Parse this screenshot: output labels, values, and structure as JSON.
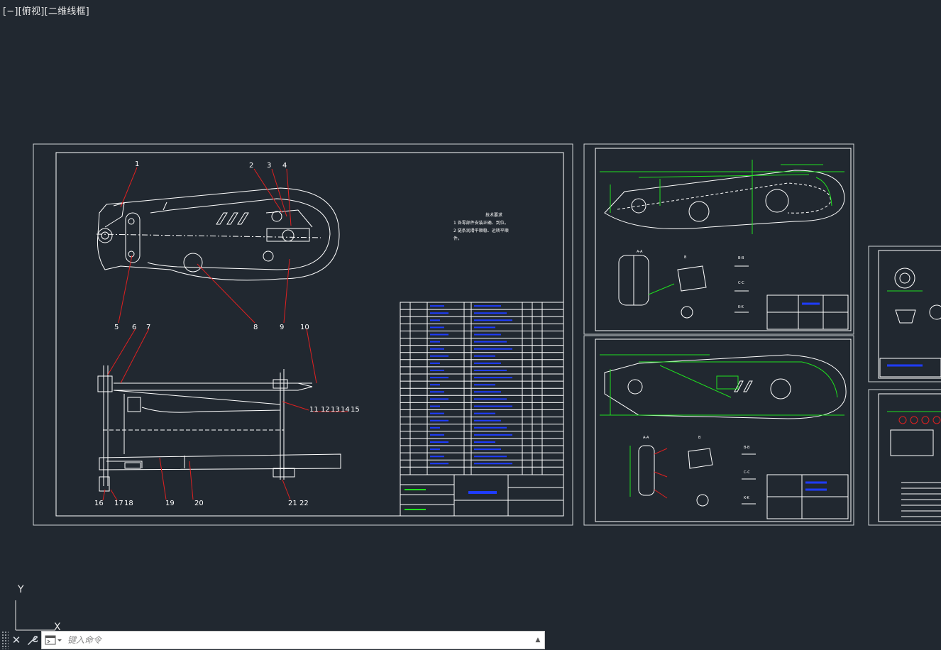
{
  "viewport": {
    "minus": "[−]",
    "view": "[俯视]",
    "style": "[二维线框]"
  },
  "colors": {
    "background": "#212830",
    "line": "#ffffff",
    "leader": "#e02020",
    "dimension": "#1fe01f",
    "tableText": "#1e3cff"
  },
  "sheet1": {
    "balloons_top": [
      "1",
      "2",
      "3",
      "4"
    ],
    "balloons_mid": [
      "5",
      "6",
      "7",
      "8",
      "9",
      "10"
    ],
    "balloons_side": [
      "11",
      "12",
      "13",
      "14",
      "15"
    ],
    "balloons_bottom": [
      "16",
      "17",
      "18",
      "19",
      "20",
      "21",
      "22"
    ],
    "notes_title": "技术要求",
    "notes": [
      "1  各零部件安装正确、到位。",
      "2  链条润滑平顺稳、运转平顺",
      "件。"
    ]
  },
  "sheet2": {
    "section_labels": [
      "A-A",
      "B",
      "B-B",
      "C-C",
      "K-K"
    ]
  },
  "sheet3": {
    "section_labels": [
      "A-A",
      "B",
      "B-B",
      "C-C",
      "K-K"
    ]
  },
  "ucs": {
    "x": "X",
    "y": "Y"
  },
  "command": {
    "placeholder": "键入命令",
    "close_icon": "close-icon",
    "customize_icon": "wrench-icon"
  }
}
